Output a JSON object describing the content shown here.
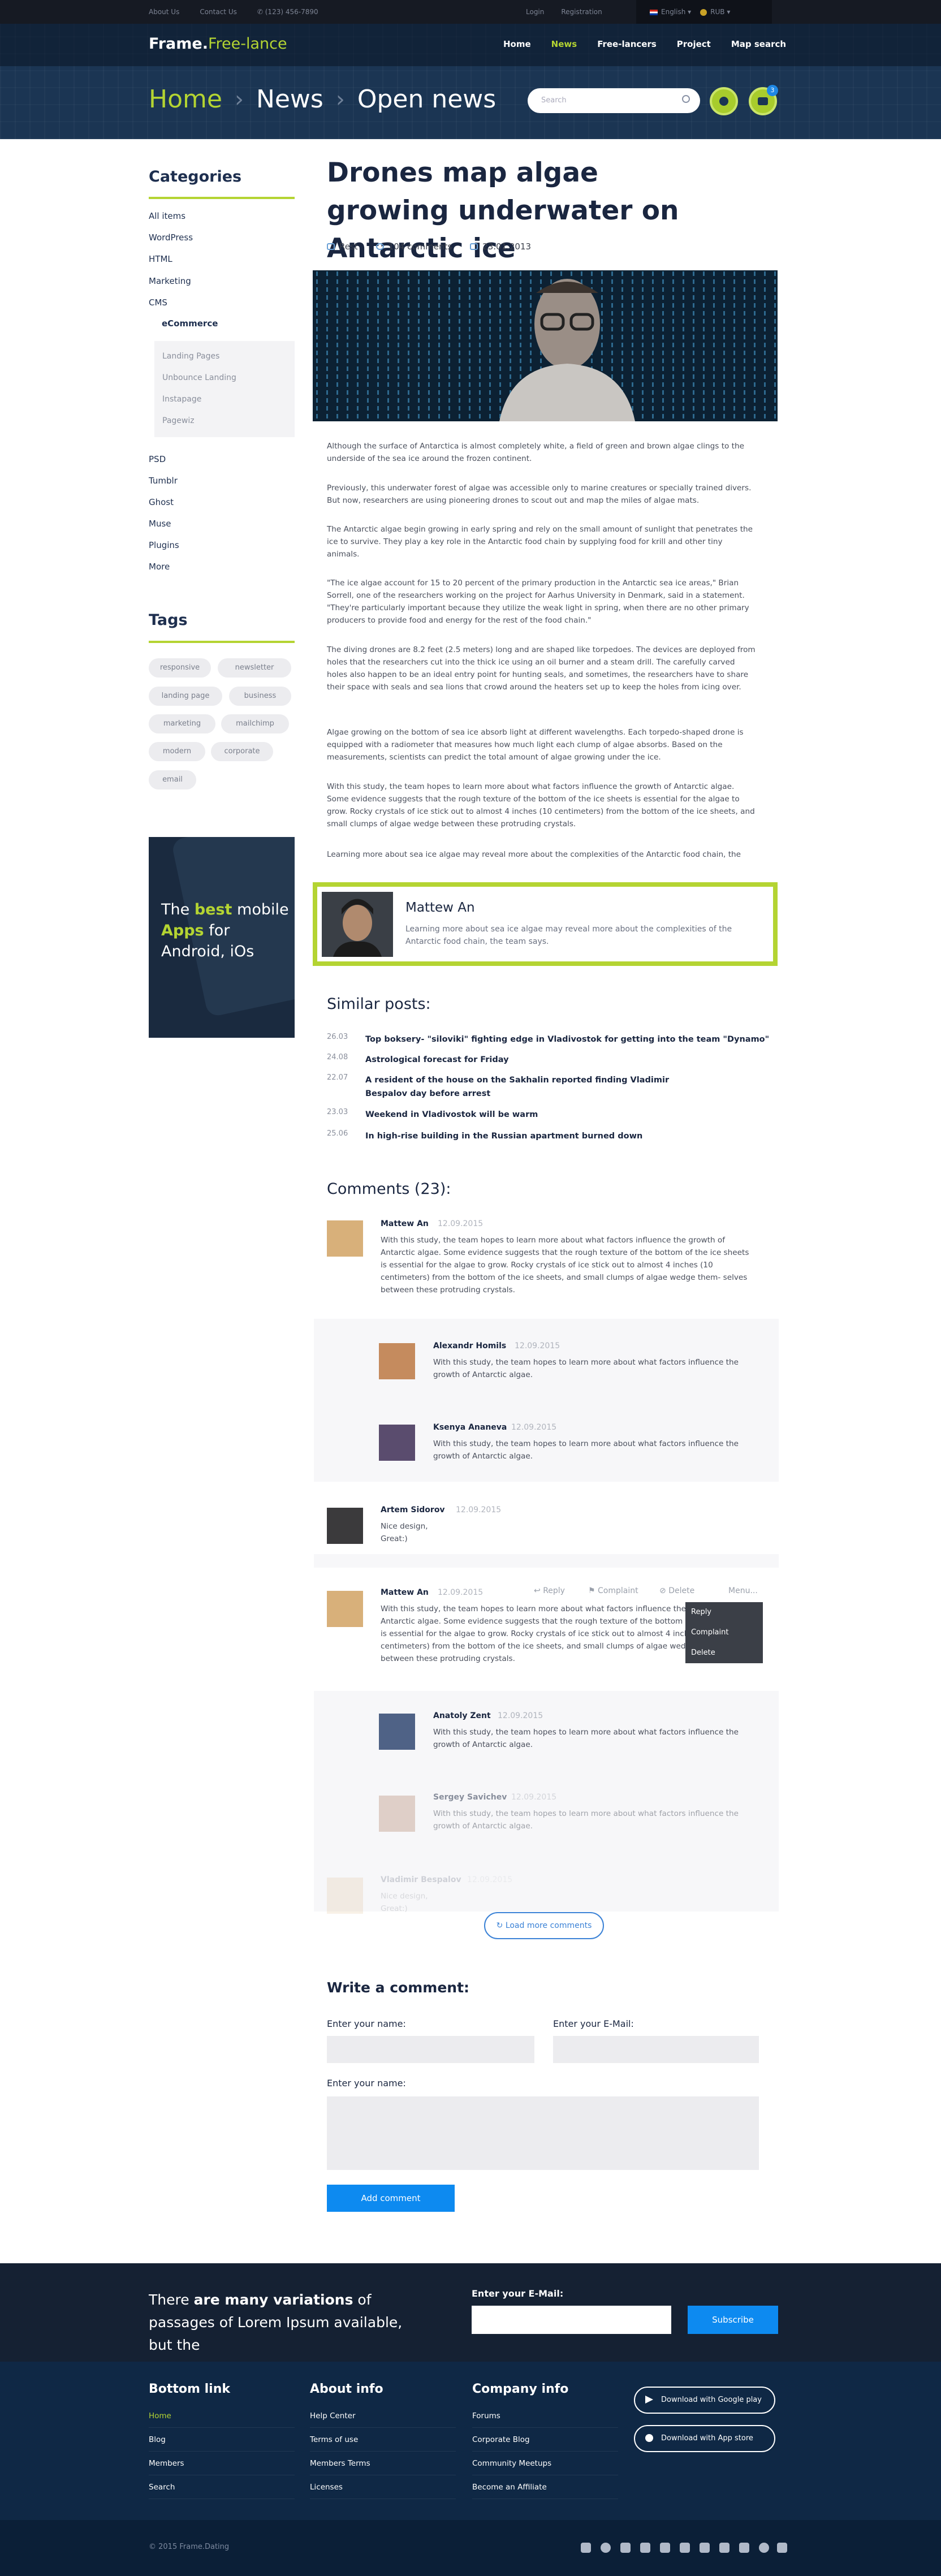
{
  "topbar": {
    "about": "About Us",
    "contact": "Contact Us",
    "phone": "(123) 456-7890",
    "login": "Login",
    "registration": "Registration",
    "language": "English",
    "currency": "RUB"
  },
  "header": {
    "logo_main": "Frame.",
    "logo_accent": "Free-lance",
    "nav": [
      "Home",
      "News",
      "Free-lancers",
      "Project",
      "Map search"
    ],
    "active_nav": "News",
    "crumbs": [
      "Home",
      "News",
      "Open news"
    ],
    "search_placeholder": "Search",
    "badge": "3"
  },
  "sidebar": {
    "categories_title": "Categories",
    "categories": [
      "All items",
      "WordPress",
      "HTML",
      "Marketing",
      "CMS"
    ],
    "cms_sub": "eCommerce",
    "ecommerce_sub": [
      "Landing Pages",
      "Unbounce Landing",
      "Instapage",
      "Pagewiz"
    ],
    "more_categories": [
      "PSD",
      "Tumblr",
      "Ghost",
      "Muse",
      "Plugins",
      "More"
    ],
    "tags_title": "Tags",
    "tags": [
      "responsive",
      "newsletter",
      "landing page",
      "business",
      "marketing",
      "mailchimp",
      "modern",
      "corporate",
      "email"
    ],
    "promo": {
      "before": "The ",
      "best": "best",
      "mid": " mobile",
      "apps": "Apps",
      "after": " for Android, iOs"
    }
  },
  "article": {
    "title": "Drones map algae growing underwater on Antarctic ice",
    "meta": {
      "category": "Rest",
      "comments": "104 comments",
      "date": "23.01.2013"
    },
    "paragraphs": [
      "Although the surface of Antarctica is almost completely white, a field of green and brown algae clings to the underside of the sea ice around the frozen continent.",
      "Previously, this underwater forest of algae was accessible only to marine creatures or specially trained divers. But now, researchers are using pioneering drones to scout out and map the miles of algae mats.",
      "The Antarctic algae begin growing in early spring and rely on the small amount of sunlight that penetrates the ice to survive. They play a key role in the Antarctic food chain by supplying food for krill and other tiny animals.",
      "\"The ice algae account for 15 to 20 percent of the primary production in the Antarctic sea ice areas,\" Brian Sorrell, one of the researchers working on the project for Aarhus University in Denmark, said in a statement. \"They're particularly important because they utilize the weak light in spring, when there are no other primary producers to provide food and energy for the rest of the food chain.\"",
      "The diving drones are 8.2 feet (2.5 meters) long and are shaped like torpedoes. The devices are deployed from holes that the researchers cut into the thick ice using an oil burner and a steam drill. The carefully carved holes also happen to be an ideal entry point for hunting seals, and sometimes, the researchers have to share their space with seals and sea lions that crowd around the heaters set up to keep the holes from icing over.",
      "Algae growing on the bottom of sea ice absorb light at different wavelengths. Each torpedo-shaped drone is equipped with a radiometer that measures how much light each clump of algae absorbs. Based on the measurements, scientists can predict the total amount of algae growing under the ice.",
      "With this study, the team hopes to learn more about what factors influence the growth of Antarctic algae. Some evidence suggests that the rough texture of the bottom of the ice sheets is essential for the algae to grow. Rocky crystals of ice stick out to almost 4 inches (10 centimeters) from the bottom of the ice sheets, and small clumps of algae wedge between these protruding crystals.",
      "Learning more about sea ice algae may reveal more about the complexities of the Antarctic food chain, the"
    ]
  },
  "author": {
    "name": "Mattew An",
    "text": "Learning more about sea ice algae may reveal more about the complexities of the Antarctic food chain, the team says."
  },
  "similar": {
    "title": "Similar posts:",
    "items": [
      {
        "date": "26.03",
        "title": "Top boksery- \"siloviki\" fighting edge in Vladivostok for getting into the team \"Dynamo\""
      },
      {
        "date": "24.08",
        "title": "Astrological forecast for Friday"
      },
      {
        "date": "22.07",
        "title": "A resident of the house on the Sakhalin reported finding Vladimir Bespalov day before arrest"
      },
      {
        "date": "23.03",
        "title": "Weekend in Vladivostok will be warm"
      },
      {
        "date": "25.06",
        "title": "In high-rise building in the Russian apartment burned down"
      }
    ]
  },
  "comments": {
    "title": "Comments (23):",
    "items": [
      {
        "name": "Mattew An",
        "date": "12.09.2015",
        "text": "With this study, the team hopes to learn more about what factors influence the growth of Antarctic algae. Some evidence suggests that the rough texture of the bottom of the ice sheets is essential for the algae to grow. Rocky crystals of ice stick out to almost 4 inches (10 centimeters) from the bottom of the ice sheets, and small clumps of algae wedge them- selves between these protruding crystals."
      },
      {
        "name": "Alexandr Homils",
        "date": "12.09.2015",
        "text": "With this study, the team hopes to learn more about what factors influence the growth of Antarctic algae."
      },
      {
        "name": "Ksenya Ananeva",
        "date": "12.09.2015",
        "text": "With this study, the team hopes to learn more about what factors influence the growth of Antarctic algae."
      },
      {
        "name": "Artem Sidorov",
        "date": "12.09.2015",
        "text": "Nice design, Great:)"
      },
      {
        "name": "Mattew An",
        "date": "12.09.2015",
        "text": "With this study, the team hopes to learn more about what factors influence the growth of Antarctic algae. Some evidence suggests that the rough texture of the bottom of the ice sheets is essential for the algae to grow. Rocky crystals of ice stick out to almost 4 inches (10 centimeters) from the bottom of the ice sheets, and small clumps of algae wedge them- selves between these protruding crystals."
      },
      {
        "name": "Anatoly Zent",
        "date": "12.09.2015",
        "text": "With this study, the team hopes to learn more about what factors influence the growth of Antarctic algae."
      },
      {
        "name": "Sergey Savichev",
        "date": "12.09.2015",
        "text": "With this study, the team hopes to learn more about what factors influence the growth of Antarctic algae."
      },
      {
        "name": "Vladimir Bespalov",
        "date": "12.09.2015",
        "text": "Nice design, Great:)"
      }
    ],
    "actions": {
      "reply": "Reply",
      "complaint": "Complaint",
      "delete": "Delete",
      "menu": "Menu..."
    },
    "menu_items": [
      "Reply",
      "Complaint",
      "Delete"
    ],
    "load_more": "Load more comments"
  },
  "form": {
    "title": "Write a comment:",
    "name_label": "Enter your name:",
    "email_label": "Enter your E-Mail:",
    "message_label": "Enter your name:",
    "submit": "Add comment"
  },
  "newsletter": {
    "text_before": "There ",
    "text_bold": "are many variations",
    "text_after": " of passages of Lorem Ipsum available, but the",
    "email_label": "Enter your E-Mail:",
    "subscribe": "Subscribe"
  },
  "footer": {
    "col1": {
      "title": "Bottom link",
      "items": [
        "Home",
        "Blog",
        "Members",
        "Search"
      ]
    },
    "col2": {
      "title": "About info",
      "items": [
        "Help Center",
        "Terms of use",
        "Members Terms",
        "Licenses"
      ]
    },
    "col3": {
      "title": "Company info",
      "items": [
        "Forums",
        "Corporate Blog",
        "Community Meetups",
        "Become an Affiliate"
      ]
    },
    "google": "Download with Google play",
    "apple": "Download with App store",
    "copyright": "© 2015 Frame.Dating"
  },
  "colors": {
    "accent": "#b4d432",
    "primary": "#0d8af0",
    "navy": "#1a2640"
  }
}
